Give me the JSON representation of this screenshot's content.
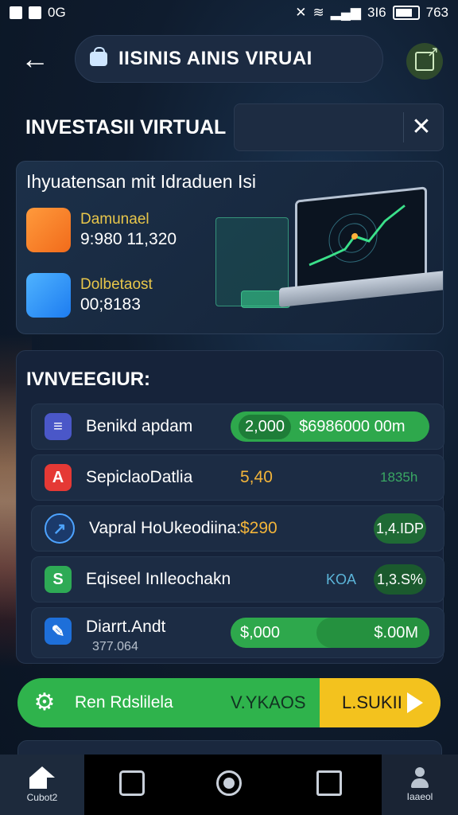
{
  "status_bar": {
    "left_text": "0G",
    "right_text": "3I6",
    "time": "763"
  },
  "header": {
    "title": "IISINIS AINIS VIRUAI"
  },
  "section": {
    "title": "INVESTASII VIRTUAL"
  },
  "overview": {
    "heading": "Ihyuatensan mit Idraduen Isi",
    "stats": [
      {
        "label": "Damunael",
        "value": "9:980 11,320"
      },
      {
        "label": "Dolbetaost",
        "value": "00;8183"
      }
    ]
  },
  "investors": {
    "heading": "IVNVEEGIUR:",
    "rows": [
      {
        "name": "Benikd apdam",
        "amount": "2,000",
        "total": "$6986000 00m"
      },
      {
        "name": "SepiclaoDatlia",
        "amount": "5,40",
        "total": "1835h"
      },
      {
        "name": "Vapral HoUkeodiina:",
        "amount": "$290",
        "total": "1,4.IDP"
      },
      {
        "name": "Eqiseel InIleochakn",
        "amount": "KOA",
        "total": "1,3.S%"
      },
      {
        "name": "Diarrt.Andt",
        "sub": "377.064",
        "amount": "$,000",
        "total": "$.00M"
      }
    ]
  },
  "action_bar": {
    "label": "Ren Rdslilela",
    "mid": "V.YKAOS",
    "cta": "L.SUKII"
  },
  "nav": {
    "home_label": "Cubot2",
    "profile_label": "Iaaeol"
  },
  "colors": {
    "accent_green": "#2fb34c",
    "accent_yellow": "#f3c21e",
    "background": "#0e1a2b"
  }
}
